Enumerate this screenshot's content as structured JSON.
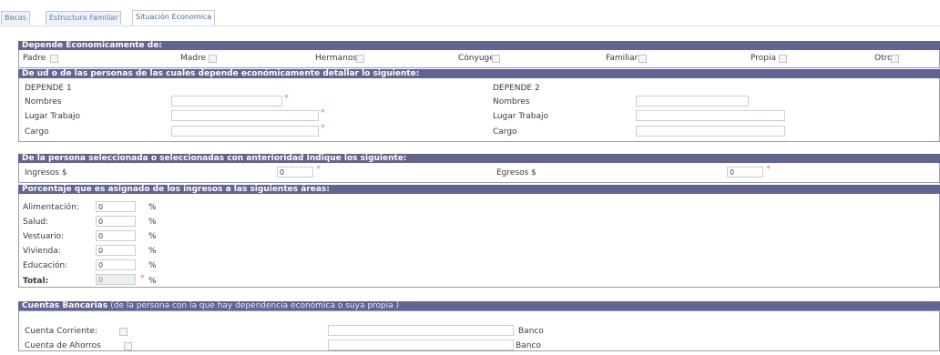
{
  "tabs": [
    "Becas",
    "Estructura Familiar",
    "Situación Economica"
  ],
  "depende": {
    "header": "Depende Economicamente de:",
    "options": [
      "Padre",
      "Madre",
      "Hermanos",
      "Cónyuge",
      "Familiar",
      "Propia",
      "Otro"
    ]
  },
  "personas": {
    "header": "De ud o de las personas de las cuales depende económicamente detallar lo siguiente:",
    "depende1": "DEPENDE 1",
    "depende2": "DEPENDE 2",
    "nombres": "Nombres",
    "lugar": "Lugar Trabajo",
    "cargo": "Cargo",
    "req": "*"
  },
  "ingresos": {
    "header": "De la persona seleccionada o seleccionadas con anterioridad Indique los siguiente:",
    "ingresos_label": "Ingresos $",
    "ingresos_value": "0",
    "egresos_label": "Egresos $",
    "egresos_value": "0"
  },
  "porcentaje": {
    "header": "Porcentaje que es asignado de los ingresos a las siguientes áreas:",
    "rows": [
      {
        "label": "Alimentación:",
        "value": "0"
      },
      {
        "label": "Salud:",
        "value": "0"
      },
      {
        "label": "Vestuario:",
        "value": "0"
      },
      {
        "label": "Vivienda:",
        "value": "0"
      },
      {
        "label": "Educación:",
        "value": "0"
      }
    ],
    "total_label": "Total:",
    "total_value": "0",
    "pct": "%"
  },
  "cuentas": {
    "header_bold": "Cuentas Bancarias",
    "header_rest": "(de la persona con la que hay dependencia económica o suya propia )",
    "corriente": "Cuenta Corriente:",
    "ahorros": "Cuenta de Ahorros",
    "banco": "Banco"
  }
}
